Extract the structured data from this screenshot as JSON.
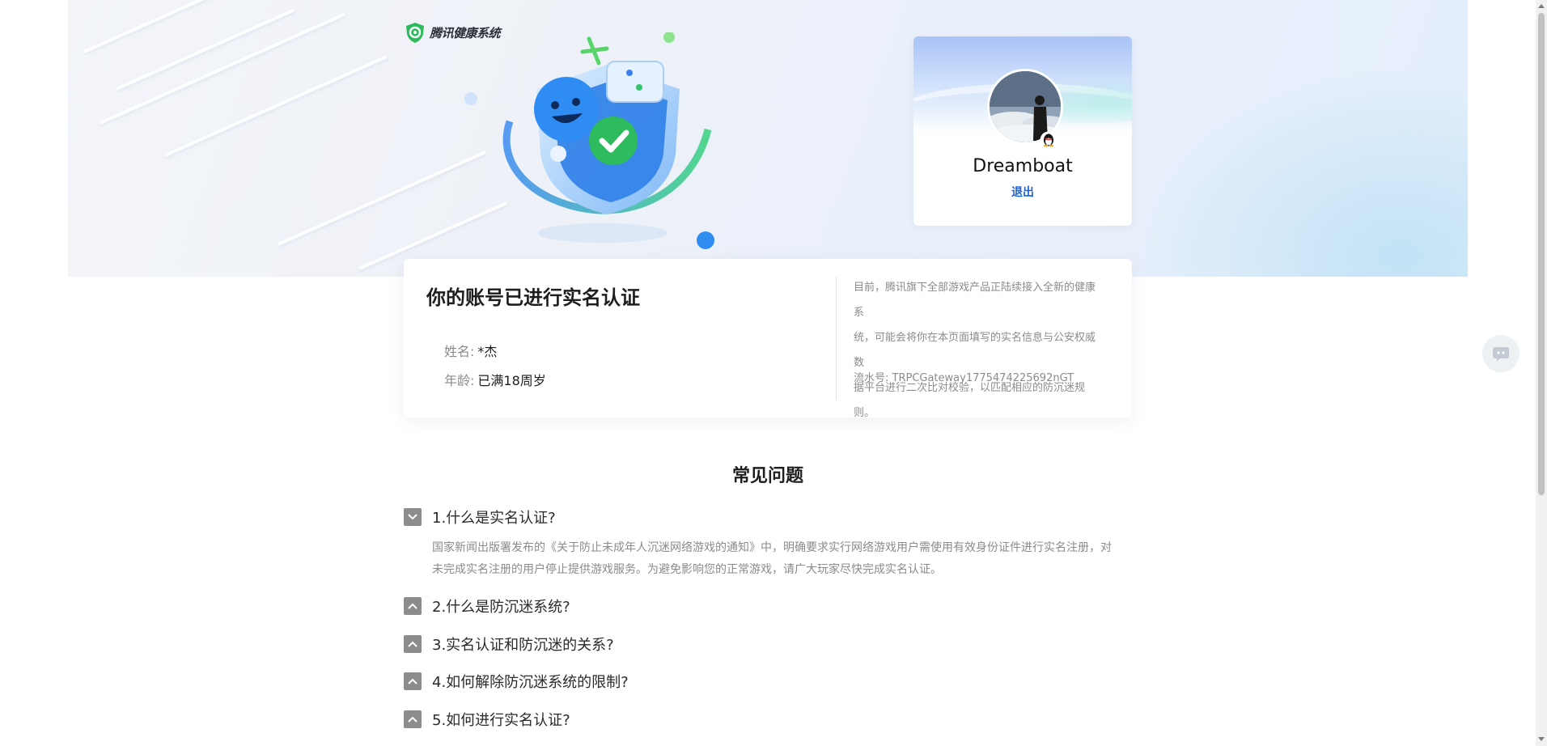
{
  "brand": {
    "logo_text": "腾讯健康系统"
  },
  "profile": {
    "nickname": "Dreamboat",
    "logout_label": "退出"
  },
  "verification": {
    "title": "你的账号已进行实名认证",
    "name_label": "姓名:",
    "name_value": "*杰",
    "age_label": "年龄:",
    "age_value": "已满18周岁",
    "note_lines": [
      "目前，腾讯旗下全部游戏产品正陆续接入全新的健康系",
      "统，可能会将你在本页面填写的实名信息与公安权威数",
      "据平台进行二次比对校验，以匹配相应的防沉迷规则。"
    ],
    "serial": "流水号: TRPCGateway1775474225692nGT"
  },
  "faq": {
    "title": "常见问题",
    "items": [
      {
        "question": "1.什么是实名认证?",
        "expanded": true
      },
      {
        "question": "2.什么是防沉迷系统?",
        "expanded": false
      },
      {
        "question": "3.实名认证和防沉迷的关系?",
        "expanded": false
      },
      {
        "question": "4.如何解除防沉迷系统的限制?",
        "expanded": false
      },
      {
        "question": "5.如何进行实名认证?",
        "expanded": false
      }
    ],
    "answer_lines": [
      "国家新闻出版署发布的《关于防止未成年人沉迷网络游戏的通知》中，明确要求实行网络游戏用户需使用有效身份证件进行实名注册，对",
      "未完成实名注册的用户停止提供游戏服务。为避免影响您的正常游戏，请广大玩家尽快完成实名认证。"
    ]
  },
  "colors": {
    "link_blue": "#1a63d9",
    "toggle_gray": "#8c8c8c",
    "brand_green": "#2dbb5d"
  },
  "icons": {
    "logo": "shield-check-icon",
    "float": "chat-icon"
  }
}
